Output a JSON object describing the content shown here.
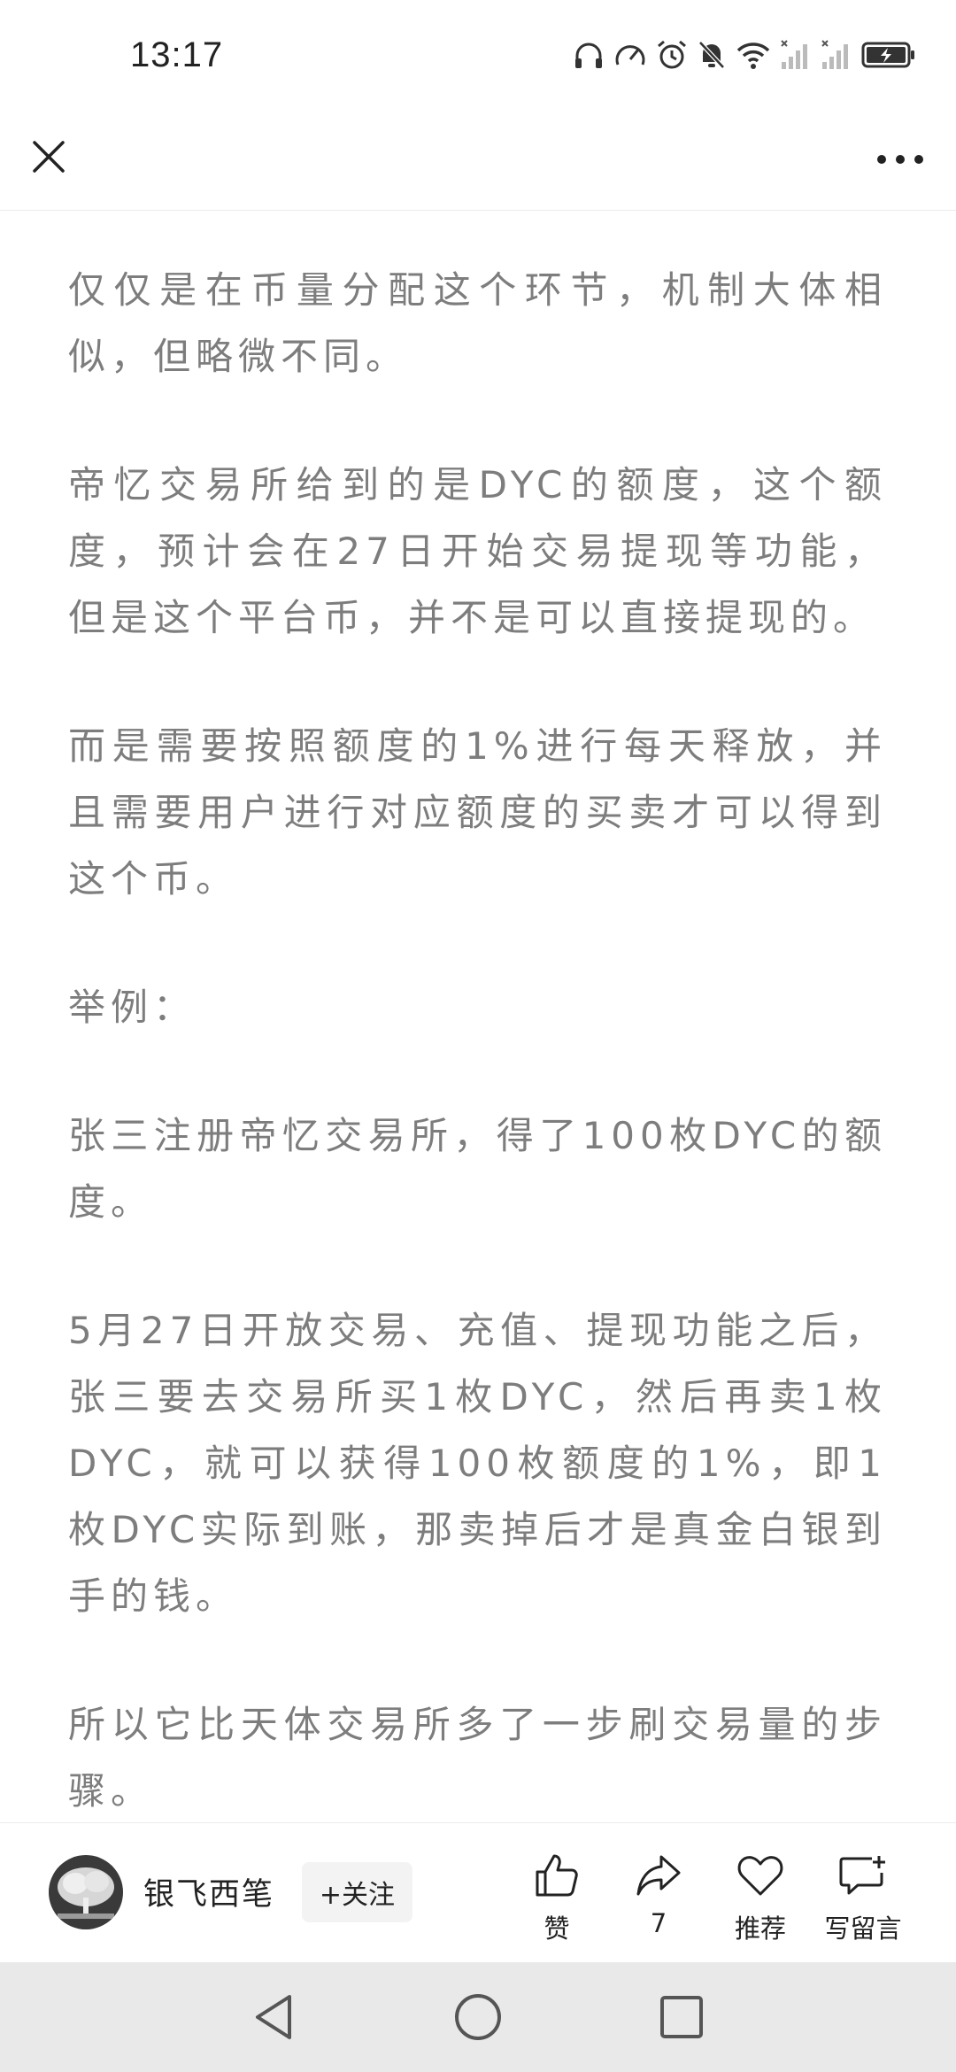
{
  "status_bar": {
    "time": "13:17",
    "icons": [
      "headphones-icon",
      "speedometer-icon",
      "alarm-icon",
      "mute-bell-icon",
      "wifi-icon",
      "signal-1-icon",
      "signal-2-icon",
      "battery-charging-icon"
    ]
  },
  "nav": {
    "close_icon": "close-icon",
    "more_icon": "more-dots-icon"
  },
  "article": {
    "paragraphs": [
      "仅仅是在币量分配这个环节，机制大体相似，但略微不同。",
      "帝忆交易所给到的是DYC的额度，这个额度，预计会在27日开始交易提现等功能，但是这个平台币，并不是可以直接提现的。",
      "而是需要按照额度的1%进行每天释放，并且需要用户进行对应额度的买卖才可以得到这个币。",
      "举例：",
      "张三注册帝忆交易所，得了100枚DYC的额度。",
      "5月27日开放交易、充值、提现功能之后，张三要去交易所买1枚DYC，然后再卖1枚DYC，就可以获得100枚额度的1%，即1枚DYC实际到账，那卖掉后才是真金白银到手的钱。",
      "所以它比天体交易所多了一步刷交易量的步骤。"
    ]
  },
  "bottom_bar": {
    "author_name": "银飞西笔",
    "follow_label": "+关注",
    "like_label": "赞",
    "share_count": "7",
    "recommend_label": "推荐",
    "comment_label": "写留言"
  },
  "system_nav": {
    "back_icon": "back-triangle-icon",
    "home_icon": "home-circle-icon",
    "recents_icon": "recents-square-icon"
  },
  "colors": {
    "text_body": "#7d7d7d",
    "text_dark": "#222222",
    "nav_background": "#e9e9e9"
  }
}
